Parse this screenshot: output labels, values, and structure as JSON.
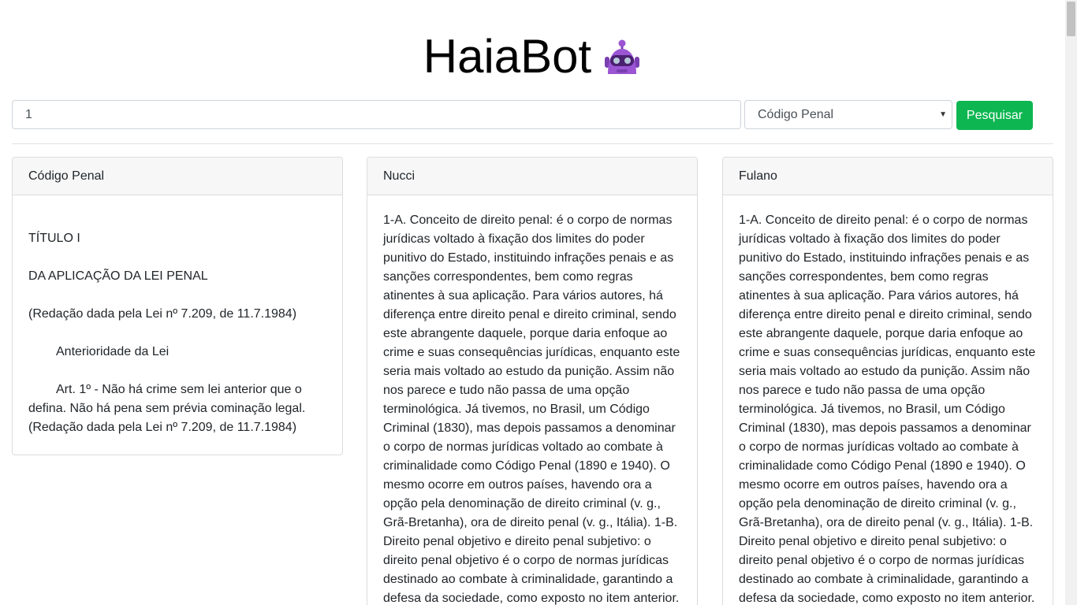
{
  "header": {
    "title": "HaiaBot",
    "logo_icon": "robot-icon"
  },
  "search": {
    "query": "1",
    "selected_code": "Código Penal",
    "button_label": "Pesquisar",
    "accent": "#0db651"
  },
  "cards": [
    {
      "header": "Código Penal",
      "lines": [
        "TÍTULO I",
        "DA APLICAÇÃO DA LEI PENAL",
        "(Redação dada pela Lei nº 7.209, de 11.7.1984)",
        "Anterioridade da Lei",
        "Art. 1º - Não há crime sem lei anterior que o defina. Não há pena sem prévia cominação legal. (Redação dada pela Lei nº 7.209, de 11.7.1984)"
      ]
    },
    {
      "header": "Nucci",
      "text": "1-A. Conceito de direito penal: é o corpo de normas jurídicas voltado à fixação dos limites do poder punitivo do Estado, instituindo infrações penais e as sanções correspondentes, bem como regras atinentes à sua aplicação. Para vários autores, há diferença entre direito penal e direito criminal, sendo este abrangente daquele, porque daria enfoque ao crime e suas consequências jurídicas, enquanto este seria mais voltado ao estudo da punição. Assim não nos parece e tudo não passa de uma opção terminológica. Já tivemos, no Brasil, um Código Criminal (1830), mas depois passamos a denominar o corpo de normas jurídicas voltado ao combate à criminalidade como Código Penal (1890 e 1940). O mesmo ocorre em outros países, havendo ora a opção pela denominação de direito criminal (v. g., Grã-Bretanha), ora de direito penal (v. g., Itália). 1-B. Direito penal objetivo e direito penal subjetivo: o direito penal objetivo é o corpo de normas jurídicas destinado ao combate à criminalidade, garantindo a defesa da sociedade, como exposto no item anterior."
    },
    {
      "header": "Fulano",
      "text": "1-A. Conceito de direito penal: é o corpo de normas jurídicas voltado à fixação dos limites do poder punitivo do Estado, instituindo infrações penais e as sanções correspondentes, bem como regras atinentes à sua aplicação. Para vários autores, há diferença entre direito penal e direito criminal, sendo este abrangente daquele, porque daria enfoque ao crime e suas consequências jurídicas, enquanto este seria mais voltado ao estudo da punição. Assim não nos parece e tudo não passa de uma opção terminológica. Já tivemos, no Brasil, um Código Criminal (1830), mas depois passamos a denominar o corpo de normas jurídicas voltado ao combate à criminalidade como Código Penal (1890 e 1940). O mesmo ocorre em outros países, havendo ora a opção pela denominação de direito criminal (v. g., Grã-Bretanha), ora de direito penal (v. g., Itália). 1-B. Direito penal objetivo e direito penal subjetivo: o direito penal objetivo é o corpo de normas jurídicas destinado ao combate à criminalidade, garantindo a defesa da sociedade, como exposto no item anterior."
    }
  ]
}
